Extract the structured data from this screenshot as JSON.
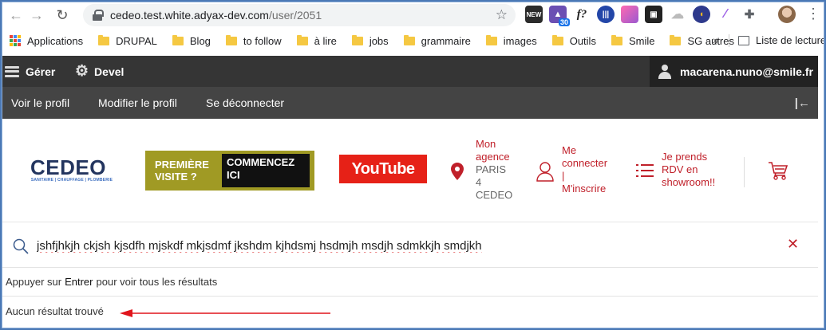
{
  "browser": {
    "url_host": "cedeo.test.white.adyax-dev.com",
    "url_path": "/user/2051",
    "extensions": [
      {
        "icon": "new-extension-icon",
        "label": "NEW",
        "color": "#2b2b2b"
      },
      {
        "icon": "graduation-cap-icon",
        "label": "30",
        "color": "#6b4fb3"
      },
      {
        "icon": "font-finder-icon",
        "label": "f?",
        "color": "#ffffff"
      },
      {
        "icon": "barcode-icon",
        "label": "",
        "color": "#2346a8"
      },
      {
        "icon": "gradient-icon",
        "label": "",
        "color": "#e85aa7"
      },
      {
        "icon": "tab-icon",
        "label": "",
        "color": "#222222"
      },
      {
        "icon": "cloud-icon",
        "label": "",
        "color": "#cfcfcf"
      },
      {
        "icon": "shield-icon",
        "label": "",
        "color": "#f1b81f"
      },
      {
        "icon": "feather-icon",
        "label": "",
        "color": "#9b5de5"
      },
      {
        "icon": "puzzle-icon",
        "label": "",
        "color": "#5f6368"
      }
    ],
    "bookmarks": [
      "Applications",
      "DRUPAL",
      "Blog",
      "to follow",
      "à lire",
      "jobs",
      "grammaire",
      "images",
      "Outils",
      "Smile",
      "SG autres"
    ],
    "more": "»",
    "reading_list": "Liste de lecture"
  },
  "admin_toolbar": {
    "manage": "Gérer",
    "devel": "Devel",
    "user": "macarena.nuno@smile.fr",
    "tray": [
      "Voir le profil",
      "Modifier le profil",
      "Se déconnecter"
    ]
  },
  "header": {
    "logo": "CEDEO",
    "logo_tag": "SANITAIRE | CHAUFFAGE | PLOMBERIE",
    "promo_left": "PREMIÈRE VISITE ?",
    "promo_right": "COMMENCEZ ICI",
    "youtube": "YouTube",
    "agency_title": "Mon agence",
    "agency_lines": [
      "PARIS",
      "4",
      "CEDEO"
    ],
    "login_lines": [
      "Me",
      "connecter",
      "|",
      "M'inscrire"
    ],
    "rdv_lines": [
      "Je prends",
      "RDV en",
      "showroom!!"
    ],
    "accent": "#c0202a"
  },
  "search": {
    "value": "jshfjhkjh ckjsh kjsdfh mjskdf mkjsdmf jkshdm kjhdsmj hsdmjh msdjh sdmkkjh smdjkh",
    "hint_before": "Appuyer sur",
    "hint_key": "Entrer",
    "hint_after": "pour voir tous les résultats",
    "no_result": "Aucun résultat trouvé"
  }
}
